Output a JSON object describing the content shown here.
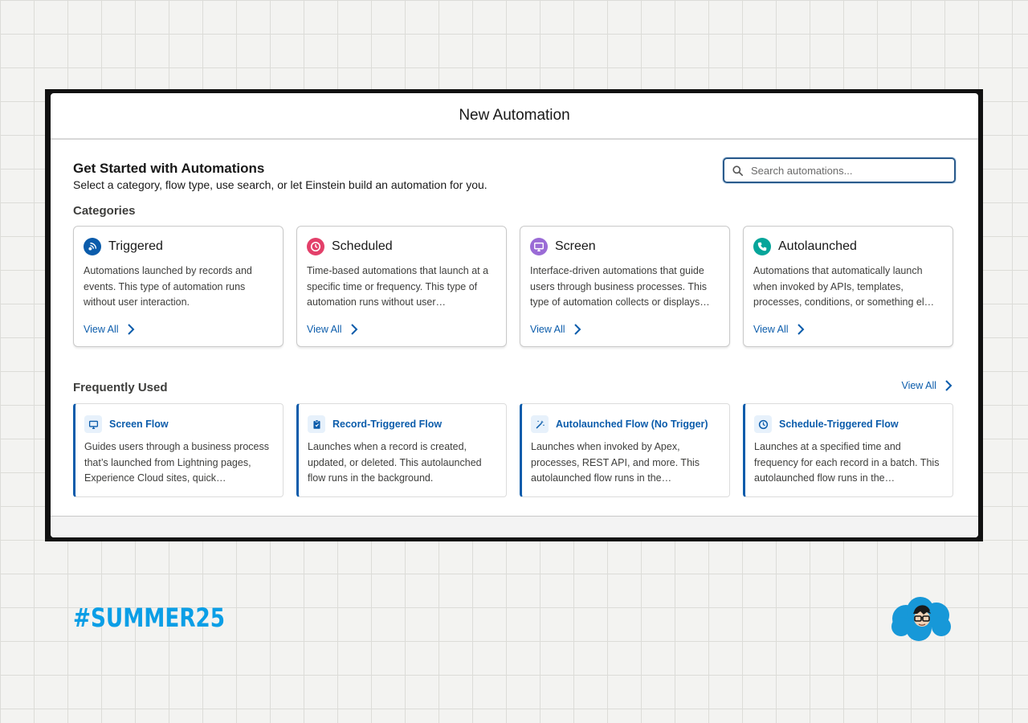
{
  "modal": {
    "title": "New Automation",
    "heading": "Get Started with Automations",
    "subheading": "Select a category, flow type, use search, or let Einstein build an automation for you.",
    "search": {
      "placeholder": "Search automations..."
    }
  },
  "categories": {
    "label": "Categories",
    "view_all_label": "View All",
    "items": [
      {
        "title": "Triggered",
        "icon": "triggered-icon",
        "color": "#0b5cab",
        "description": "Automations launched by records and events. This type of automation runs without user interaction."
      },
      {
        "title": "Scheduled",
        "icon": "clock-icon",
        "color": "#e3406a",
        "description": "Time-based automations that launch at a specific time or frequency. This type of automation runs without user…"
      },
      {
        "title": "Screen",
        "icon": "monitor-icon",
        "color": "#9a6bd6",
        "description": "Interface-driven automations that guide users through business processes. This type of automation collects or displays…"
      },
      {
        "title": "Autolaunched",
        "icon": "phone-icon",
        "color": "#06a59a",
        "description": "Automations that automatically launch when invoked by APIs, templates, processes, conditions, or something el…"
      }
    ]
  },
  "frequently_used": {
    "label": "Frequently Used",
    "view_all_label": "View All",
    "items": [
      {
        "title": "Screen Flow",
        "icon": "monitor-icon",
        "description": "Guides users through a business process that’s launched from Lightning pages, Experience Cloud sites, quick…"
      },
      {
        "title": "Record-Triggered Flow",
        "icon": "clipboard-icon",
        "description": "Launches when a record is created, updated, or deleted. This autolaunched flow runs in the background."
      },
      {
        "title": "Autolaunched Flow (No Trigger)",
        "icon": "magic-wand-icon",
        "description": "Launches when invoked by Apex, processes, REST API, and more. This autolaunched flow runs in the…"
      },
      {
        "title": "Schedule-Triggered Flow",
        "icon": "clock-icon",
        "description": "Launches at a specified time and frequency for each record in a batch. This autolaunched flow runs in the…"
      }
    ]
  },
  "branding": {
    "hashtag": "#SUMMER25",
    "accent": "#0a9ee6"
  }
}
